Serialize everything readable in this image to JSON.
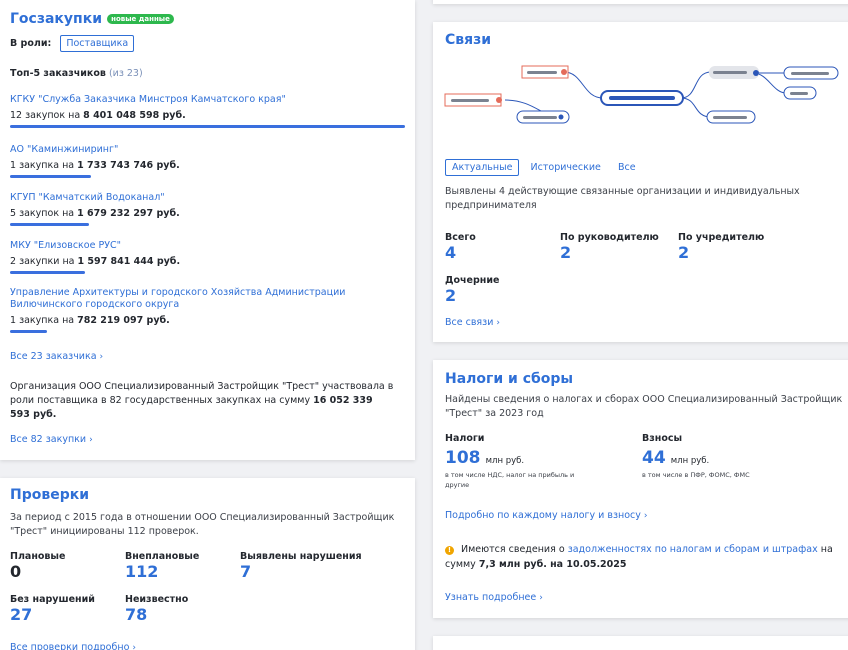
{
  "goszakupki": {
    "title": "Госзакупки",
    "badge": "новые данные",
    "role_label": "В роли:",
    "role_value": "Поставщика",
    "top5_label": "Топ-5 заказчиков",
    "top5_count": "(из 23)",
    "customers": [
      {
        "name": "КГКУ \"Служба Заказчика Минстроя Камчатского края\"",
        "count": "12 закупок на",
        "amount": "8 401 048 598 руб.",
        "share": 1.0
      },
      {
        "name": "АО \"Каминжиниринг\"",
        "count": "1 закупка на",
        "amount": "1 733 743 746 руб.",
        "share": 0.206
      },
      {
        "name": "КГУП \"Камчатский Водоканал\"",
        "count": "5 закупок на",
        "amount": "1 679 232 297 руб.",
        "share": 0.2
      },
      {
        "name": "МКУ \"Елизовское РУС\"",
        "count": "2 закупки на",
        "amount": "1 597 841 444 руб.",
        "share": 0.19
      },
      {
        "name": "Управление Архитектуры и городского Хозяйства Администрации Вилючинского городского округа",
        "count": "1 закупка на",
        "amount": "782 219 097 руб.",
        "share": 0.093
      }
    ],
    "all_customers_link": "Все 23 заказчика",
    "summary_text": "Организация ООО Специализированный Застройщик \"Трест\" участвовала в роли поставщика в 82 государственных закупках на сумму",
    "summary_amount": "16 052 339 593 руб.",
    "all_purchases_link": "Все 82 закупки"
  },
  "proverki": {
    "title": "Проверки",
    "text": "За период с 2015 года в отношении ООО Специализированный Застройщик \"Трест\" инициированы 112 проверок.",
    "stats": [
      {
        "label": "Плановые",
        "value": "0"
      },
      {
        "label": "Внеплановые",
        "value": "112"
      },
      {
        "label": "Выявлены нарушения",
        "value": "7"
      },
      {
        "label": "Без нарушений",
        "value": "27"
      },
      {
        "label": "Неизвестно",
        "value": "78"
      }
    ],
    "link": "Все проверки подробно"
  },
  "svyazi": {
    "title": "Связи",
    "tabs": [
      "Актуальные",
      "Исторические",
      "Все"
    ],
    "text": "Выявлены 4 действующие связанные организации и индивидуальных предпринимателя",
    "stats": [
      {
        "label": "Всего",
        "value": "4"
      },
      {
        "label": "По руководителю",
        "value": "2"
      },
      {
        "label": "По учредителю",
        "value": "2"
      },
      {
        "label": "Дочерние",
        "value": "2"
      }
    ],
    "link": "Все связи"
  },
  "nalogi": {
    "title": "Налоги и сборы",
    "text": "Найдены сведения о налогах и сборах ООО Специализированный Застройщик \"Трест\" за 2023 год",
    "taxes_label": "Налоги",
    "taxes_value": "108",
    "taxes_unit": "млн руб.",
    "taxes_note": "в том числе НДС, налог на прибыль и другие",
    "contrib_label": "Взносы",
    "contrib_value": "44",
    "contrib_unit": "млн руб.",
    "contrib_note": "в том числе в ПФР, ФОМС, ФМС",
    "detail_link": "Подробно по каждому налогу и взносу",
    "warning_pre": "Имеются сведения о",
    "warning_link": "задолженностях по налогам и сборам и штрафах",
    "warning_mid": "на сумму",
    "warning_amount": "7,3 млн руб. на 10.05.2025",
    "more_link": "Узнать подробнее",
    "warning_color": "#f0a500"
  }
}
